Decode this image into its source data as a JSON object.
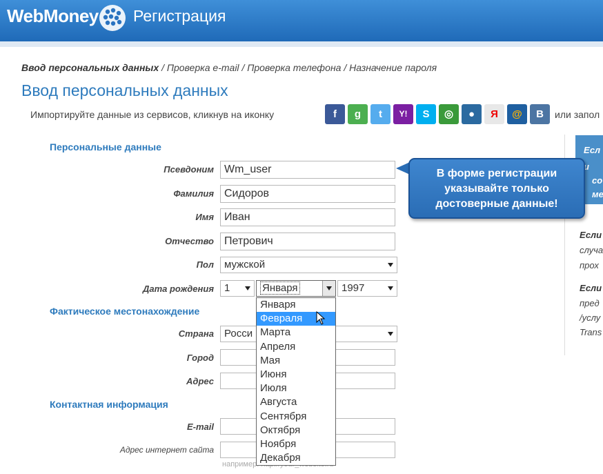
{
  "header": {
    "logo": "WebMoney",
    "title": "Регистрация"
  },
  "breadcrumb": {
    "current": "Ввод персональных данных",
    "steps": [
      "/ Проверка e-mail",
      "/ Проверка телефона",
      "/ Назначение пароля"
    ]
  },
  "page_title": "Ввод персональных данных",
  "import": {
    "text": "Импортируйте данные из сервисов, кликнув на иконку",
    "suffix": "или запол",
    "icons": [
      {
        "name": "facebook-icon",
        "glyph": "f",
        "color": "#3b5998"
      },
      {
        "name": "google-icon",
        "glyph": "g",
        "color": "#4caf50"
      },
      {
        "name": "twitter-icon",
        "glyph": "t",
        "color": "#55acee"
      },
      {
        "name": "yahoo-icon",
        "glyph": "Y!",
        "color": "#7b1fa2"
      },
      {
        "name": "skype-icon",
        "glyph": "S",
        "color": "#00aff0"
      },
      {
        "name": "openid-icon",
        "glyph": "◎",
        "color": "#3a9a3a"
      },
      {
        "name": "myworld-icon",
        "glyph": "●",
        "color": "#2b6aa0"
      },
      {
        "name": "yandex-icon",
        "glyph": "Я",
        "color": "#e8e8e8"
      },
      {
        "name": "mailru-icon",
        "glyph": "@",
        "color": "#1f5fa0"
      },
      {
        "name": "vkontakte-icon",
        "glyph": "В",
        "color": "#4c75a3"
      }
    ]
  },
  "sections": {
    "personal": "Персональные данные",
    "location": "Фактическое местонахождение",
    "contacts": "Контактная информация"
  },
  "fields": {
    "nickname": {
      "label": "Псевдоним",
      "value": "Wm_user"
    },
    "lastname": {
      "label": "Фамилия",
      "value": "Сидоров"
    },
    "firstname": {
      "label": "Имя",
      "value": "Иван"
    },
    "patronymic": {
      "label": "Отчество",
      "value": "Петрович"
    },
    "gender": {
      "label": "Пол",
      "value": "мужской"
    },
    "birthdate": {
      "label": "Дата рождения",
      "day": "1",
      "month": "Января",
      "year": "1997"
    },
    "country": {
      "label": "Страна",
      "value": "Росси"
    },
    "city": {
      "label": "Город",
      "value": ""
    },
    "address": {
      "label": "Адрес",
      "value": ""
    },
    "email": {
      "label": "E-mail",
      "value": ""
    },
    "website": {
      "label": "Адрес интернет сайта",
      "value": "",
      "hint": "например: http://your_website.ru"
    }
  },
  "month_dropdown": {
    "options": [
      "Января",
      "Февраля",
      "Марта",
      "Апреля",
      "Мая",
      "Июня",
      "Июля",
      "Августа",
      "Сентября",
      "Октября",
      "Ноября",
      "Декабря"
    ],
    "highlighted": "Февраля"
  },
  "callout": {
    "line1": "В форме регистрации",
    "line2": "указывайте только",
    "line3": "достоверные данные!"
  },
  "side_panel": {
    "blue_lines": [
      "Есл",
      "и",
      "со",
      "ме"
    ],
    "block1": [
      "Если",
      "случа",
      "прох"
    ],
    "block2": [
      "Если",
      "пред",
      "/услу",
      "Trans"
    ]
  }
}
